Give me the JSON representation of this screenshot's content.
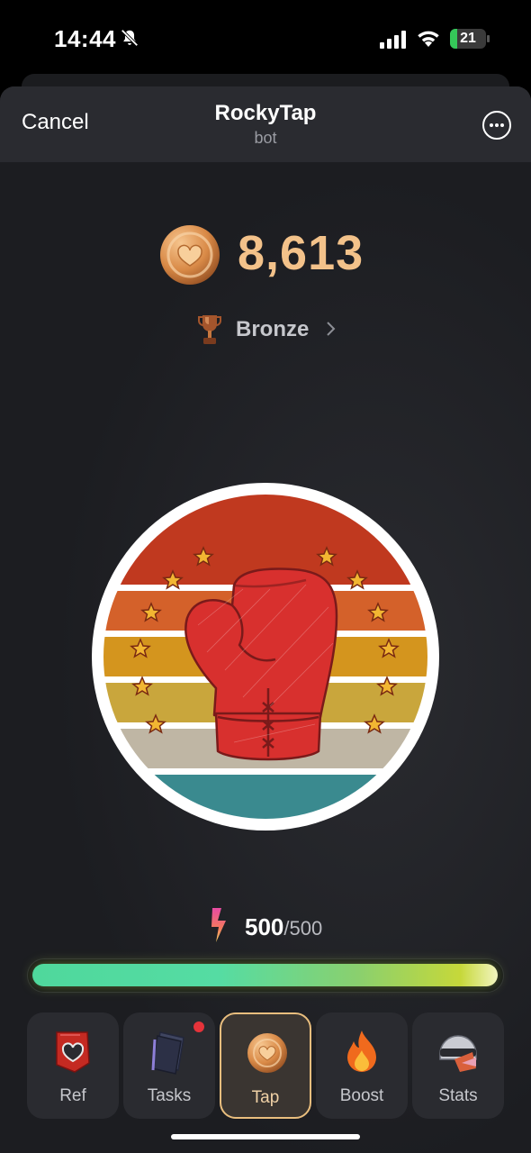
{
  "status_bar": {
    "time": "14:44",
    "battery": "21",
    "battery_level": 0.21
  },
  "header": {
    "cancel_label": "Cancel",
    "title": "RockyTap",
    "subtitle": "bot"
  },
  "balance": {
    "value": "8,613"
  },
  "league": {
    "label": "Bronze"
  },
  "energy": {
    "current": "500",
    "max": "500",
    "level": 1.0
  },
  "nav": {
    "items": [
      {
        "label": "Ref",
        "icon": "heart-shield-icon",
        "active": false
      },
      {
        "label": "Tasks",
        "icon": "notebook-icon",
        "active": false,
        "badge": true
      },
      {
        "label": "Tap",
        "icon": "coin-icon",
        "active": true
      },
      {
        "label": "Boost",
        "icon": "fire-icon",
        "active": false
      },
      {
        "label": "Stats",
        "icon": "helmet-icon",
        "active": false
      }
    ]
  },
  "colors": {
    "accent": "#f3c28a",
    "background": "#1c1d21",
    "header": "#2a2b30",
    "energy_start": "#4fd89c",
    "energy_end": "#c6d83a"
  }
}
